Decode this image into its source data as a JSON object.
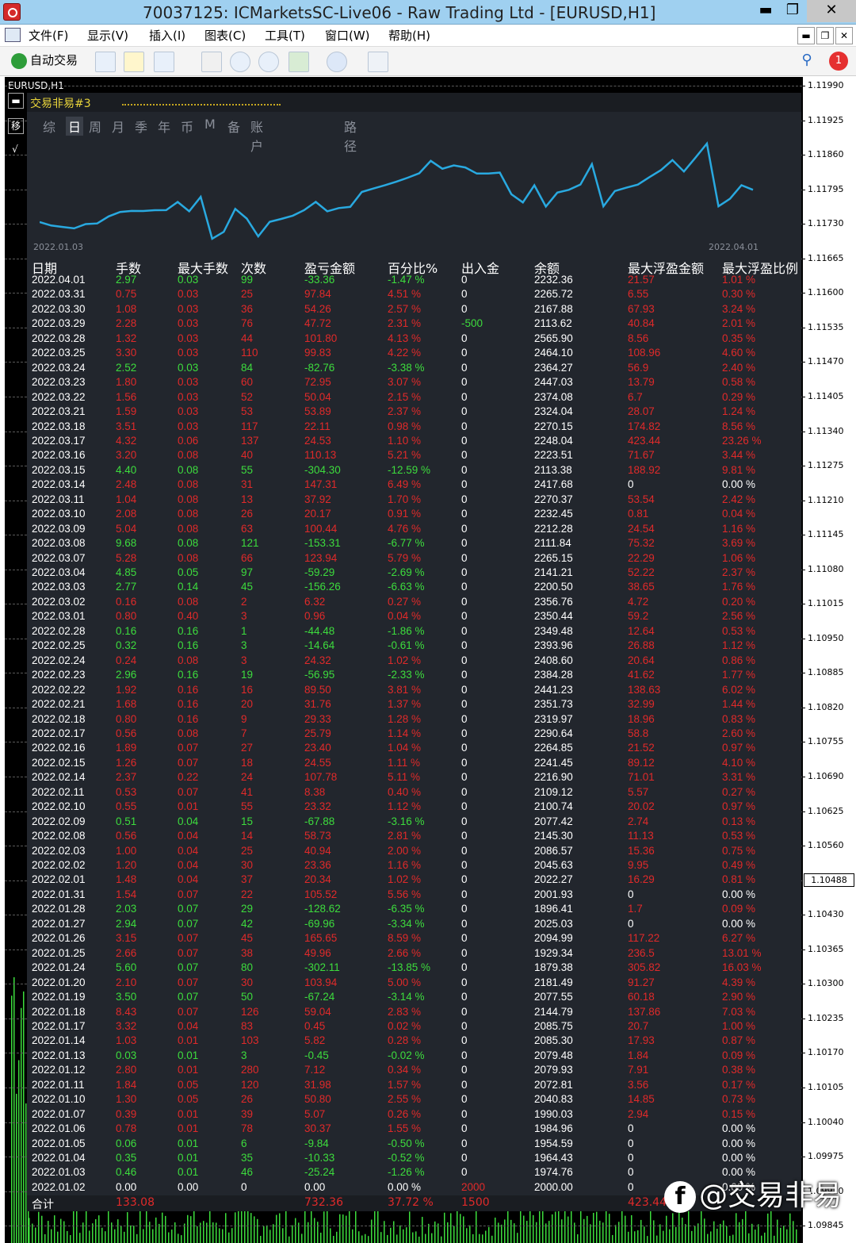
{
  "window": {
    "title": "70037125: ICMarketsSC-Live06 - Raw Trading Ltd - [EURUSD,H1]",
    "min_label": "▬",
    "max_label": "❐",
    "close_label": "✕"
  },
  "menu": {
    "items": [
      "文件(F)",
      "显示(V)",
      "插入(I)",
      "图表(C)",
      "工具(T)",
      "窗口(W)",
      "帮助(H)"
    ],
    "mdi_buttons": [
      "▬",
      "❐",
      "✕"
    ]
  },
  "toolbar": {
    "autotrade_label": "自动交易",
    "icons": [
      "new-order-icon",
      "favorites-icon",
      "navigator-icon",
      "chart-type-icon",
      "zoom-in-icon",
      "zoom-out-icon",
      "tile-icon",
      "clock-icon",
      "template-icon",
      "search-icon",
      "notification-icon"
    ],
    "notification_count": "1"
  },
  "chart": {
    "symbol_label": "EURUSD,H1",
    "price_levels": [
      "1.11990",
      "1.11925",
      "1.11860",
      "1.11795",
      "1.11730",
      "1.11665",
      "1.11600",
      "1.11535",
      "1.11470",
      "1.11405",
      "1.11340",
      "1.11275",
      "1.11210",
      "1.11145",
      "1.11080",
      "1.11015",
      "1.10950",
      "1.10885",
      "1.10820",
      "1.10755",
      "1.10690",
      "1.10625",
      "1.10560",
      "1.10488",
      "1.10430",
      "1.10365",
      "1.10300",
      "1.10235",
      "1.10170",
      "1.10105",
      "1.10040",
      "1.09975",
      "1.09910",
      "1.09845"
    ],
    "current_price": "1.10488",
    "colors": {
      "up": "#3ddc3d",
      "background": "#000000"
    }
  },
  "panel": {
    "title": "交易非易#3",
    "left_buttons": [
      "▬",
      "移",
      "√"
    ],
    "tabs": [
      "综",
      "日",
      "周",
      "月",
      "季",
      "年",
      "币",
      "M",
      "备",
      "账户",
      "路径"
    ],
    "active_tab": "日",
    "curve_date_start": "2022.01.03",
    "curve_date_end": "2022.04.01",
    "headers": [
      "日期",
      "手数",
      "最大手数",
      "次数",
      "盈亏金额",
      "百分比%",
      "出入金",
      "余额",
      "最大浮盈金额",
      "最大浮盈比例"
    ],
    "rows": [
      [
        "2022.04.01",
        "2.97",
        "0.03",
        "99",
        "-33.36",
        "-1.47 %",
        "0",
        "2232.36",
        "21.57",
        "1.01 %"
      ],
      [
        "2022.03.31",
        "0.75",
        "0.03",
        "25",
        "97.84",
        "4.51 %",
        "0",
        "2265.72",
        "6.55",
        "0.30 %"
      ],
      [
        "2022.03.30",
        "1.08",
        "0.03",
        "36",
        "54.26",
        "2.57 %",
        "0",
        "2167.88",
        "67.93",
        "3.24 %"
      ],
      [
        "2022.03.29",
        "2.28",
        "0.03",
        "76",
        "47.72",
        "2.31 %",
        "-500",
        "2113.62",
        "40.84",
        "2.01 %"
      ],
      [
        "2022.03.28",
        "1.32",
        "0.03",
        "44",
        "101.80",
        "4.13 %",
        "0",
        "2565.90",
        "8.56",
        "0.35 %"
      ],
      [
        "2022.03.25",
        "3.30",
        "0.03",
        "110",
        "99.83",
        "4.22 %",
        "0",
        "2464.10",
        "108.96",
        "4.60 %"
      ],
      [
        "2022.03.24",
        "2.52",
        "0.03",
        "84",
        "-82.76",
        "-3.38 %",
        "0",
        "2364.27",
        "56.9",
        "2.40 %"
      ],
      [
        "2022.03.23",
        "1.80",
        "0.03",
        "60",
        "72.95",
        "3.07 %",
        "0",
        "2447.03",
        "13.79",
        "0.58 %"
      ],
      [
        "2022.03.22",
        "1.56",
        "0.03",
        "52",
        "50.04",
        "2.15 %",
        "0",
        "2374.08",
        "6.7",
        "0.29 %"
      ],
      [
        "2022.03.21",
        "1.59",
        "0.03",
        "53",
        "53.89",
        "2.37 %",
        "0",
        "2324.04",
        "28.07",
        "1.24 %"
      ],
      [
        "2022.03.18",
        "3.51",
        "0.03",
        "117",
        "22.11",
        "0.98 %",
        "0",
        "2270.15",
        "174.82",
        "8.56 %"
      ],
      [
        "2022.03.17",
        "4.32",
        "0.06",
        "137",
        "24.53",
        "1.10 %",
        "0",
        "2248.04",
        "423.44",
        "23.26 %"
      ],
      [
        "2022.03.16",
        "3.20",
        "0.08",
        "40",
        "110.13",
        "5.21 %",
        "0",
        "2223.51",
        "71.67",
        "3.44 %"
      ],
      [
        "2022.03.15",
        "4.40",
        "0.08",
        "55",
        "-304.30",
        "-12.59 %",
        "0",
        "2113.38",
        "188.92",
        "9.81 %"
      ],
      [
        "2022.03.14",
        "2.48",
        "0.08",
        "31",
        "147.31",
        "6.49 %",
        "0",
        "2417.68",
        "0",
        "0.00 %"
      ],
      [
        "2022.03.11",
        "1.04",
        "0.08",
        "13",
        "37.92",
        "1.70 %",
        "0",
        "2270.37",
        "53.54",
        "2.42 %"
      ],
      [
        "2022.03.10",
        "2.08",
        "0.08",
        "26",
        "20.17",
        "0.91 %",
        "0",
        "2232.45",
        "0.81",
        "0.04 %"
      ],
      [
        "2022.03.09",
        "5.04",
        "0.08",
        "63",
        "100.44",
        "4.76 %",
        "0",
        "2212.28",
        "24.54",
        "1.16 %"
      ],
      [
        "2022.03.08",
        "9.68",
        "0.08",
        "121",
        "-153.31",
        "-6.77 %",
        "0",
        "2111.84",
        "75.32",
        "3.69 %"
      ],
      [
        "2022.03.07",
        "5.28",
        "0.08",
        "66",
        "123.94",
        "5.79 %",
        "0",
        "2265.15",
        "22.29",
        "1.06 %"
      ],
      [
        "2022.03.04",
        "4.85",
        "0.05",
        "97",
        "-59.29",
        "-2.69 %",
        "0",
        "2141.21",
        "52.22",
        "2.37 %"
      ],
      [
        "2022.03.03",
        "2.77",
        "0.14",
        "45",
        "-156.26",
        "-6.63 %",
        "0",
        "2200.50",
        "38.65",
        "1.76 %"
      ],
      [
        "2022.03.02",
        "0.16",
        "0.08",
        "2",
        "6.32",
        "0.27 %",
        "0",
        "2356.76",
        "4.72",
        "0.20 %"
      ],
      [
        "2022.03.01",
        "0.80",
        "0.40",
        "3",
        "0.96",
        "0.04 %",
        "0",
        "2350.44",
        "59.2",
        "2.56 %"
      ],
      [
        "2022.02.28",
        "0.16",
        "0.16",
        "1",
        "-44.48",
        "-1.86 %",
        "0",
        "2349.48",
        "12.64",
        "0.53 %"
      ],
      [
        "2022.02.25",
        "0.32",
        "0.16",
        "3",
        "-14.64",
        "-0.61 %",
        "0",
        "2393.96",
        "26.88",
        "1.12 %"
      ],
      [
        "2022.02.24",
        "0.24",
        "0.08",
        "3",
        "24.32",
        "1.02 %",
        "0",
        "2408.60",
        "20.64",
        "0.86 %"
      ],
      [
        "2022.02.23",
        "2.96",
        "0.16",
        "19",
        "-56.95",
        "-2.33 %",
        "0",
        "2384.28",
        "41.62",
        "1.77 %"
      ],
      [
        "2022.02.22",
        "1.92",
        "0.16",
        "16",
        "89.50",
        "3.81 %",
        "0",
        "2441.23",
        "138.63",
        "6.02 %"
      ],
      [
        "2022.02.21",
        "1.68",
        "0.16",
        "20",
        "31.76",
        "1.37 %",
        "0",
        "2351.73",
        "32.99",
        "1.44 %"
      ],
      [
        "2022.02.18",
        "0.80",
        "0.16",
        "9",
        "29.33",
        "1.28 %",
        "0",
        "2319.97",
        "18.96",
        "0.83 %"
      ],
      [
        "2022.02.17",
        "0.56",
        "0.08",
        "7",
        "25.79",
        "1.14 %",
        "0",
        "2290.64",
        "58.8",
        "2.60 %"
      ],
      [
        "2022.02.16",
        "1.89",
        "0.07",
        "27",
        "23.40",
        "1.04 %",
        "0",
        "2264.85",
        "21.52",
        "0.97 %"
      ],
      [
        "2022.02.15",
        "1.26",
        "0.07",
        "18",
        "24.55",
        "1.11 %",
        "0",
        "2241.45",
        "89.12",
        "4.10 %"
      ],
      [
        "2022.02.14",
        "2.37",
        "0.22",
        "24",
        "107.78",
        "5.11 %",
        "0",
        "2216.90",
        "71.01",
        "3.31 %"
      ],
      [
        "2022.02.11",
        "0.53",
        "0.07",
        "41",
        "8.38",
        "0.40 %",
        "0",
        "2109.12",
        "5.57",
        "0.27 %"
      ],
      [
        "2022.02.10",
        "0.55",
        "0.01",
        "55",
        "23.32",
        "1.12 %",
        "0",
        "2100.74",
        "20.02",
        "0.97 %"
      ],
      [
        "2022.02.09",
        "0.51",
        "0.04",
        "15",
        "-67.88",
        "-3.16 %",
        "0",
        "2077.42",
        "2.74",
        "0.13 %"
      ],
      [
        "2022.02.08",
        "0.56",
        "0.04",
        "14",
        "58.73",
        "2.81 %",
        "0",
        "2145.30",
        "11.13",
        "0.53 %"
      ],
      [
        "2022.02.03",
        "1.00",
        "0.04",
        "25",
        "40.94",
        "2.00 %",
        "0",
        "2086.57",
        "15.36",
        "0.75 %"
      ],
      [
        "2022.02.02",
        "1.20",
        "0.04",
        "30",
        "23.36",
        "1.16 %",
        "0",
        "2045.63",
        "9.95",
        "0.49 %"
      ],
      [
        "2022.02.01",
        "1.48",
        "0.04",
        "37",
        "20.34",
        "1.02 %",
        "0",
        "2022.27",
        "16.29",
        "0.81 %"
      ],
      [
        "2022.01.31",
        "1.54",
        "0.07",
        "22",
        "105.52",
        "5.56 %",
        "0",
        "2001.93",
        "0",
        "0.00 %"
      ],
      [
        "2022.01.28",
        "2.03",
        "0.07",
        "29",
        "-128.62",
        "-6.35 %",
        "0",
        "1896.41",
        "1.7",
        "0.09 %"
      ],
      [
        "2022.01.27",
        "2.94",
        "0.07",
        "42",
        "-69.96",
        "-3.34 %",
        "0",
        "2025.03",
        "0",
        "0.00 %"
      ],
      [
        "2022.01.26",
        "3.15",
        "0.07",
        "45",
        "165.65",
        "8.59 %",
        "0",
        "2094.99",
        "117.22",
        "6.27 %"
      ],
      [
        "2022.01.25",
        "2.66",
        "0.07",
        "38",
        "49.96",
        "2.66 %",
        "0",
        "1929.34",
        "236.5",
        "13.01 %"
      ],
      [
        "2022.01.24",
        "5.60",
        "0.07",
        "80",
        "-302.11",
        "-13.85 %",
        "0",
        "1879.38",
        "305.82",
        "16.03 %"
      ],
      [
        "2022.01.20",
        "2.10",
        "0.07",
        "30",
        "103.94",
        "5.00 %",
        "0",
        "2181.49",
        "91.27",
        "4.39 %"
      ],
      [
        "2022.01.19",
        "3.50",
        "0.07",
        "50",
        "-67.24",
        "-3.14 %",
        "0",
        "2077.55",
        "60.18",
        "2.90 %"
      ],
      [
        "2022.01.18",
        "8.43",
        "0.07",
        "126",
        "59.04",
        "2.83 %",
        "0",
        "2144.79",
        "137.86",
        "7.03 %"
      ],
      [
        "2022.01.17",
        "3.32",
        "0.04",
        "83",
        "0.45",
        "0.02 %",
        "0",
        "2085.75",
        "20.7",
        "1.00 %"
      ],
      [
        "2022.01.14",
        "1.03",
        "0.01",
        "103",
        "5.82",
        "0.28 %",
        "0",
        "2085.30",
        "17.93",
        "0.87 %"
      ],
      [
        "2022.01.13",
        "0.03",
        "0.01",
        "3",
        "-0.45",
        "-0.02 %",
        "0",
        "2079.48",
        "1.84",
        "0.09 %"
      ],
      [
        "2022.01.12",
        "2.80",
        "0.01",
        "280",
        "7.12",
        "0.34 %",
        "0",
        "2079.93",
        "7.91",
        "0.38 %"
      ],
      [
        "2022.01.11",
        "1.84",
        "0.05",
        "120",
        "31.98",
        "1.57 %",
        "0",
        "2072.81",
        "3.56",
        "0.17 %"
      ],
      [
        "2022.01.10",
        "1.30",
        "0.05",
        "26",
        "50.80",
        "2.55 %",
        "0",
        "2040.83",
        "14.85",
        "0.73 %"
      ],
      [
        "2022.01.07",
        "0.39",
        "0.01",
        "39",
        "5.07",
        "0.26 %",
        "0",
        "1990.03",
        "2.94",
        "0.15 %"
      ],
      [
        "2022.01.06",
        "0.78",
        "0.01",
        "78",
        "30.37",
        "1.55 %",
        "0",
        "1984.96",
        "0",
        "0.00 %"
      ],
      [
        "2022.01.05",
        "0.06",
        "0.01",
        "6",
        "-9.84",
        "-0.50 %",
        "0",
        "1954.59",
        "0",
        "0.00 %"
      ],
      [
        "2022.01.04",
        "0.35",
        "0.01",
        "35",
        "-10.33",
        "-0.52 %",
        "0",
        "1964.43",
        "0",
        "0.00 %"
      ],
      [
        "2022.01.03",
        "0.46",
        "0.01",
        "46",
        "-25.24",
        "-1.26 %",
        "0",
        "1974.76",
        "0",
        "0.00 %"
      ],
      [
        "2022.01.02",
        "0.00",
        "0.00",
        "0",
        "0.00",
        "0.00 %",
        "2000",
        "2000.00",
        "0",
        "0.00 %"
      ]
    ],
    "total": {
      "label": "合计",
      "lots": "133.08",
      "profit": "732.36",
      "percent": "37.72 %",
      "deposit": "1500",
      "max_float": "423.44"
    },
    "colors": {
      "positive": "#e02a2a",
      "negative": "#3ddc3d",
      "curve": "#29a9e0",
      "panel_bg": "#22262d"
    }
  },
  "watermark": {
    "logo": "f",
    "text": "@交易非易"
  }
}
